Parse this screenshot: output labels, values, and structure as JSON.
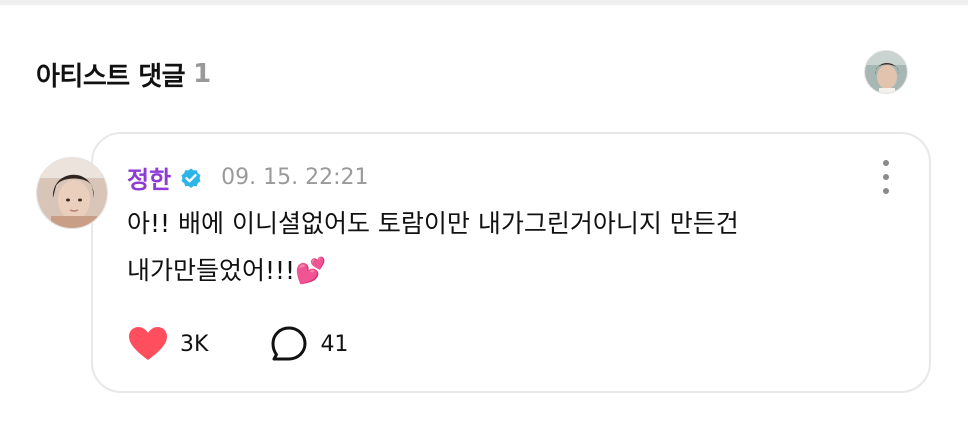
{
  "section": {
    "title": "아티스트 댓글",
    "count": "1"
  },
  "comment": {
    "author": "정한",
    "timestamp": "09. 15. 22:21",
    "text": "아!! 배에 이니셜없어도 토람이만 내가그린거아니지 만든건\n내가만들었어!!!💕",
    "likes": "3K",
    "replies": "41"
  },
  "icons": {
    "verified": "verified-badge-icon",
    "more": "more-vertical-icon",
    "like": "heart-icon",
    "reply": "speech-bubble-icon"
  },
  "colors": {
    "author": "#8e3bd6",
    "verified": "#2bb5e8",
    "heart": "#ff4f5e",
    "timestamp": "#9a9a9a"
  }
}
